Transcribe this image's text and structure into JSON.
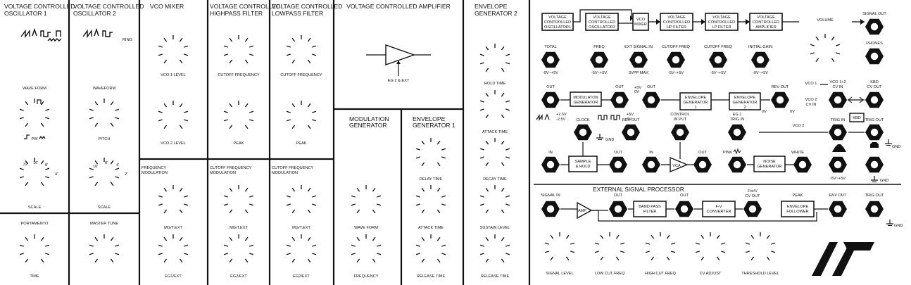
{
  "sections": {
    "vco1": {
      "title_l1": "VOLTAGE CONTROLLED",
      "title_l2": "OSCILLATOR   1",
      "waveform": "WAVE FORM",
      "pw": "PW",
      "scale": "SCALE",
      "footages": [
        "32'",
        "16'",
        "8'",
        "4'"
      ]
    },
    "vco2": {
      "title_l1": "VOLTAGE CONTROLLED",
      "title_l2": "OSCILLATOR   2",
      "ring": "RING",
      "waveform": "WAVEFORM",
      "pitch": "PITCH",
      "scale": "SCALE",
      "footages": [
        "16'",
        "8'",
        "4'",
        "2'"
      ]
    },
    "mixer": {
      "title": "VCO MIXER",
      "k1": "VCO 1 LEVEL",
      "k2": "VCO 2 LEVEL"
    },
    "hpf": {
      "title_l1": "VOLTAGE CONTROLLED",
      "title_l2": "HIGHPASS FILTER",
      "k1": "CUTOFF FREQUENCY",
      "k2": "PEAK"
    },
    "lpf": {
      "title_l1": "VOLTAGE CONTROLLED",
      "title_l2": "LOWPASS FILTER",
      "k1": "CUTOFF FREQUENCY",
      "k2": "PEAK"
    },
    "vca": {
      "title": "VOLTAGE CONTROLLED AMPLIFIER",
      "label": "EG 2 & EXT"
    },
    "eg2": {
      "title_l1": "ENVELOPE",
      "title_l2": "GENERATOR 2",
      "knobs": [
        "HOLD TIME",
        "ATTACK TIME",
        "DECAY TIME",
        "SUSTAIN LEVEL",
        "RELEASE TIME"
      ]
    },
    "portamento": {
      "title": "PORTAMENTO",
      "knob": "TIME"
    },
    "master": {
      "title": "MASTER TUNE"
    },
    "fm": {
      "title_l1": "FREQUENCY",
      "title_l2": "MODULATION",
      "k1": "MG/T.EXT",
      "k2": "EG1/EXT"
    },
    "hpmod": {
      "title_l1": "CUTOFF FREQUENCY",
      "title_l2": "MODULATION",
      "k1": "MG/T.EXT",
      "k2": "EG2/EXT"
    },
    "lpmod": {
      "title_l1": "CUTOFF FREQUENCY",
      "title_l2": "MODULATION",
      "k1": "MG/T.EXT",
      "k2": "EG2/EXT"
    },
    "mg": {
      "title_l1": "MODULATION",
      "title_l2": "GENERATOR",
      "k1": "WAVE FORM",
      "k2": "FREQUENCY"
    },
    "eg1": {
      "title_l1": "ENVELOPE",
      "title_l2": "GENERATOR 1",
      "knobs": [
        "DELAY TIME",
        "ATTACK TIME",
        "RELEASE TIME"
      ]
    }
  },
  "patch": {
    "chain": [
      {
        "l1": "VOLTAGE",
        "l2": "CONTROLLED",
        "l3": "OSCILLATOR1"
      },
      {
        "l1": "VOLTAGE",
        "l2": "CONTROLLED",
        "l3": "OSCILLATOR2"
      },
      {
        "l1": "VCO",
        "l2": "MIXER"
      },
      {
        "l1": "VOLTAGE",
        "l2": "CONTROLLED",
        "l3": "HP FILTER"
      },
      {
        "l1": "VOLTAGE",
        "l2": "CONTROLLED",
        "l3": "LP FILTER"
      },
      {
        "l1": "VOLTAGE",
        "l2": "CONTROLLED",
        "l3": "AMPLIFIER"
      }
    ],
    "volume": "VOLUME",
    "signal_out": "SIGNAL OUT",
    "phones": "PHONES",
    "row1": {
      "total": "TOTAL",
      "freq": "FREQ",
      "ext_signal_in": "EXT SIGNAL IN",
      "cutoff1": "CUTOFF FREQ",
      "cutoff2": "CUTOFF FREQ",
      "initial_gain": "INITIAL GAIN"
    },
    "row1_ranges": {
      "total": "-5V~+5V",
      "freq": "-5V~+5V",
      "ext": "3VPP MAX",
      "cut1": "-5V~+5V",
      "cut2": "-5V~+5V",
      "gain": "-0V~+5V"
    },
    "row2": {
      "out1": "OUT",
      "mg_l1": "MODULATON",
      "mg_l2": "GENERATOR",
      "out2": "OUT",
      "out3": "OUT",
      "eg1_l1": "ENVELOPE",
      "eg1_l2": "GENERATOR",
      "eg1_l3": "1",
      "eg2_l1": "ENVELOPE",
      "eg2_l2": "GENERATOR",
      "eg2_l3": "2",
      "rev_out": "REV OUT",
      "vco1": "VCO 1",
      "vco12_l1": "VCO 1+2",
      "vco12_l2": "CV IN",
      "kbd_l1": "KBD",
      "kbd_l2": "CV OUT",
      "vco2cv_l1": "VCO 2",
      "vco2cv_l2": "CV IN",
      "vco2": "VCO 2",
      "v25a": "+2.5V",
      "v25b": "-2.5V",
      "v5a": "+5V",
      "v5b": "0V",
      "v5c": "+5V",
      "v5d": "0V",
      "zero_v": "0V",
      "zero_v2": "0V"
    },
    "row3": {
      "clock": "CLOCK",
      "rev_out": "REV OUT",
      "control_l1": "CONTROL",
      "control_l2": "IN PUT",
      "eg1_l1": "EG 1",
      "eg1_l2": "TRIG IN",
      "trig_in": "TRIG IN",
      "kbd": "KBD",
      "trig_out": "TRIG OUT",
      "gnd1": "GND",
      "gnd2": "GND"
    },
    "row4": {
      "in1": "IN",
      "sh_l1": "SAMPLE",
      "sh_l2": "& HOLD",
      "out1": "OUT",
      "in2": "IN",
      "vca": "VCA",
      "out2": "OUT",
      "pink": "PINK",
      "noise_l1": "NOISE",
      "noise_l2": "GENERATOR",
      "white": "WHITE",
      "range": "-5V~+5V",
      "gnd": "GND"
    }
  },
  "esp": {
    "title": "EXTERNAL SIGNAL PROCESSOR",
    "signal_in": "SIGNAL IN",
    "amp": "AMP",
    "out1": "OUT",
    "bpf_l1": "BAND PASS",
    "bpf_l2": "FILTER",
    "out2": "OUT",
    "fv_l1": "F-V",
    "fv_l2": "CONVERTER",
    "fv_out_l1": "For/V",
    "fv_out_l2": "CV OUT",
    "peak": "PEAK",
    "env_l1": "ENVELOPE",
    "env_l2": "FOLLOWER",
    "env_out": "ENV OUT",
    "trig_out": "TRIG OUT",
    "gnd": "GND",
    "knobs": [
      "SIGNAL LEVEL",
      "LOW CUT FREQ",
      "HIGH CUT FREQ",
      "CV ADJUST",
      "THRESHOLD LEVEL"
    ]
  }
}
